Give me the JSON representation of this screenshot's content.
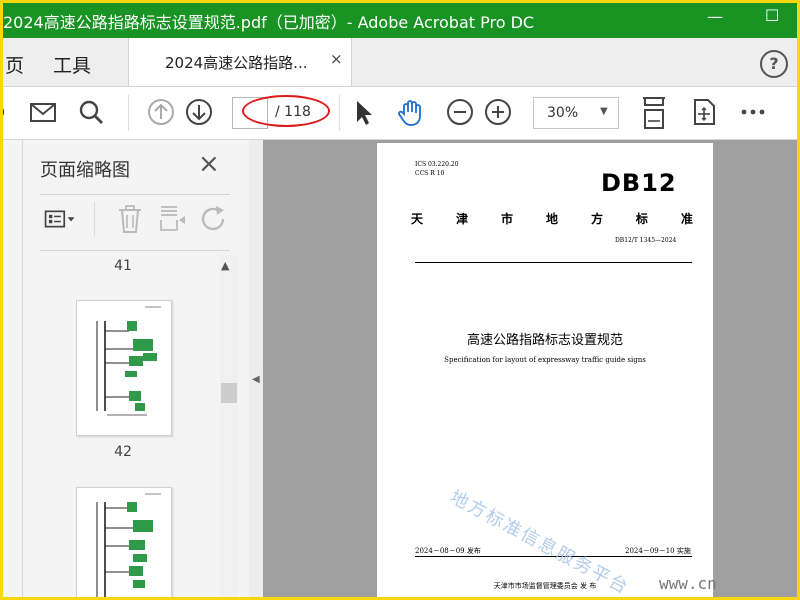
{
  "window": {
    "title": "2024高速公路指路标志设置规范.pdf（已加密）- Adobe Acrobat Pro DC",
    "minimize_glyph": "—",
    "maximize_glyph": "☐"
  },
  "tabs": {
    "home": "页",
    "tools": "工具",
    "document": "2024高速公路指路...",
    "close_glyph": "×",
    "help_glyph": "?"
  },
  "toolbar": {
    "page_input_value": "",
    "page_total": "/ 118",
    "zoom": "30%",
    "zoom_arrow": "▼",
    "icons": [
      "email-icon",
      "search-icon",
      "previous-page-icon",
      "next-page-icon",
      "select-cursor-icon",
      "hand-icon",
      "zoom-out-icon",
      "zoom-in-icon",
      "fit-page-icon",
      "rotate-view-icon",
      "more-icon"
    ]
  },
  "thumbnail_panel": {
    "title": "页面缩略图",
    "close_glyph": "×",
    "page_labels": [
      "41",
      "42"
    ],
    "scroll_up_glyph": "▲"
  },
  "splitter_arrow": "◀",
  "pdf_page": {
    "ics_line": "ICS  03.220.20",
    "ccs_line": "CCS  R 10",
    "db": "DB12",
    "standard_type": [
      "天",
      "津",
      "市",
      "地",
      "方",
      "标",
      "准"
    ],
    "code": "DB12/T 1345—2024",
    "title": "高速公路指路标志设置规范",
    "subtitle": "Specification for layout of expressway traffic guide signs",
    "publish_date": "2024－08－09 发布",
    "implement_date": "2024－09－10 实施",
    "issuer": "天津市市场监督管理委员会      发 布"
  },
  "watermark": "地方标准信息服务平台",
  "corner_text": "www.cn",
  "colors": {
    "titlebar": "#199424",
    "frame": "#f8d80a",
    "annotation": "#dd1a1a",
    "hand_tool": "#1a6fd0"
  }
}
